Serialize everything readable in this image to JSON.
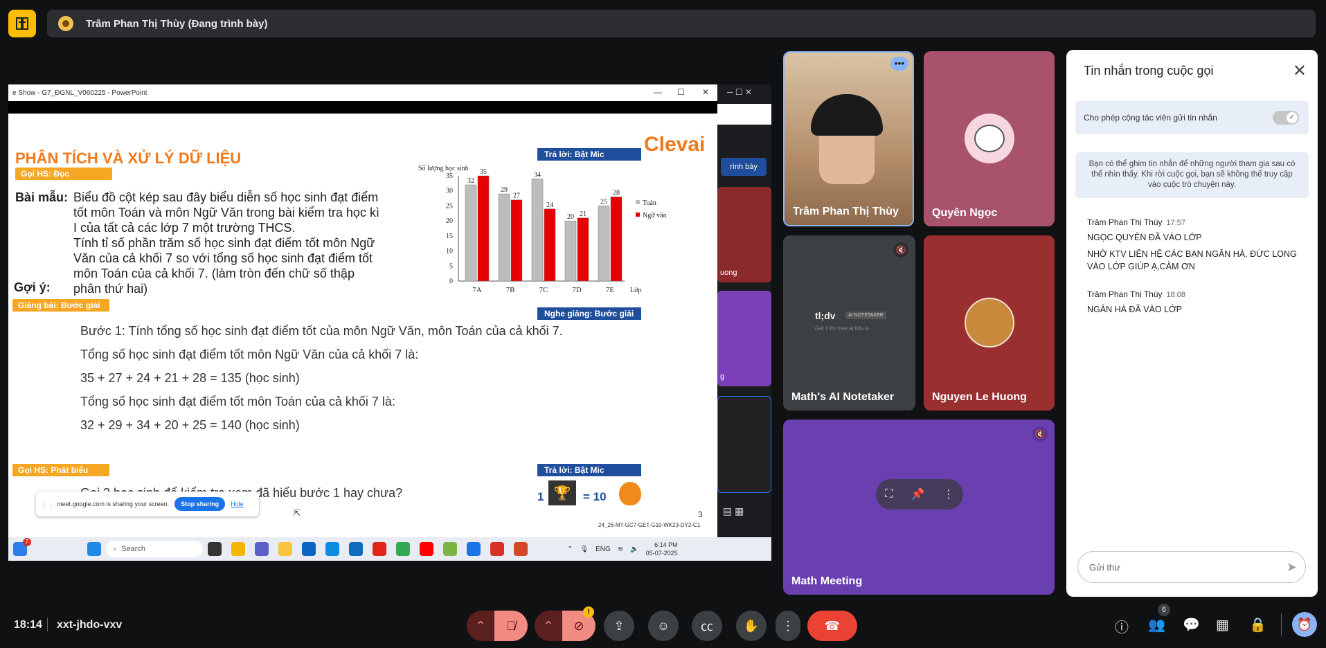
{
  "app": {
    "presenter_banner": "Trâm Phan Thị Thùy (Đang trình bày)",
    "time": "18:14",
    "meeting_code": "xxt-jhdo-vxv",
    "participants_count": "6"
  },
  "shared_window": {
    "title": "e Show - G7_ĐGNL_V060225 - PowerPoint",
    "share_notice": "meet.google.com is sharing your screen.",
    "stop_sharing": "Stop sharing",
    "hide": "Hide",
    "side_label": "rình bày",
    "side_tile_label": "uong",
    "side_tile_label2": "g"
  },
  "slide": {
    "title": "PHÂN TÍCH VÀ XỬ LÝ DỮ LIỆU",
    "brand": "Clevai",
    "tag_read": "Gọi HS: Đọc",
    "tag_teach": "Giảng bài: Bước giải",
    "tag_speak": "Gọi HS: Phát biểu",
    "tag_answer_top": "Trả lời: Bật Mic",
    "tag_listen": "Nghe giảng: Bước giải",
    "tag_answer_bottom": "Trả lời: Bật Mic",
    "sample_label": "Bài mẫu:",
    "hint_label": "Gợi ý:",
    "problem_lines": [
      "Biểu đồ cột kép sau đây biểu diễn số học sinh đạt điểm",
      "tốt môn Toán và môn Ngữ Văn trong bài kiểm tra học kì",
      "I của tất cả các lớp 7 một trường THCS.",
      "Tính tỉ số phần trăm số học sinh đạt điểm tốt môn Ngữ",
      "Văn của cả khối 7 so với tổng số học sinh đạt điểm tốt",
      "môn Toán của cả khối 7. (làm tròn đến chữ số thập",
      "phân thứ hai)"
    ],
    "steps": [
      "Bước 1: Tính tổng số học sinh đạt điểm tốt của môn Ngữ Văn, môn Toán của cả khối 7.",
      "Tổng số học sinh đạt điểm tốt môn Ngữ Văn của cả khối 7 là:",
      "35 + 27 + 24 + 21 + 28 = 135 (học sinh)",
      "Tổng số học sinh đạt điểm tốt môn Toán của cả khối 7 là:",
      "32 + 29 + 34 + 20 + 25 = 140 (học sinh)"
    ],
    "question": "Gọi 2 học sinh để kiểm tra xem đã hiểu bước 1 hay chưa?",
    "reward_count": "1",
    "reward_equals": "= 10",
    "page_number": "3",
    "footer_code": "24_26-MT-GC7-GET-G10-WK23-DY2-C1"
  },
  "chart_data": {
    "type": "bar",
    "ylabel": "Số lượng học sinh",
    "xlabel": "Lớp",
    "categories": [
      "7A",
      "7B",
      "7C",
      "7D",
      "7E"
    ],
    "series": [
      {
        "name": "Toán",
        "values": [
          32,
          29,
          34,
          20,
          25
        ],
        "color": "#bdbdbd"
      },
      {
        "name": "Ngữ văn",
        "values": [
          35,
          27,
          24,
          21,
          28
        ],
        "color": "#e60000"
      }
    ],
    "yticks": [
      "0",
      "5",
      "10",
      "15",
      "20",
      "25",
      "30",
      "35"
    ],
    "ylim": [
      0,
      35
    ],
    "legend": "right"
  },
  "taskbar": {
    "search": "Search",
    "lang": "ENG",
    "clock_time": "6:14 PM",
    "clock_date": "05-07-2025",
    "badge": "7"
  },
  "tiles": [
    {
      "name": "Trâm Phan Thị Thùy",
      "color": "#c9a27a"
    },
    {
      "name": "Quyên Ngọc",
      "color": "#a8526b"
    },
    {
      "name": "Math's AI Notetaker",
      "color": "#3c4043"
    },
    {
      "name": "Nguyen Le Huong",
      "color": "#9a2f2f"
    },
    {
      "name": "Math Meeting",
      "color": "#6a3fb0"
    }
  ],
  "notetaker": {
    "brand": "tl;dv",
    "badge": "AI NOTETAKER",
    "tagline": "Get it for free at tldv.io"
  },
  "chat": {
    "title": "Tin nhắn trong cuộc gọi",
    "allow_label": "Cho phép cộng tác viên gửi tin nhắn",
    "pin_info": "Bạn có thể ghim tin nhắn để những người tham gia sau có thể nhìn thấy. Khi rời cuộc gọi, bạn sẽ không thể truy cập vào cuộc trò chuyện này.",
    "messages": [
      {
        "author": "Trâm Phan Thị Thùy",
        "time": "17:57",
        "lines": [
          "NGỌC QUYÊN ĐÃ VÀO LỚP",
          "NHỜ KTV LIÊN HỆ CÁC BẠN NGÂN HÀ, ĐỨC LONG VÀO LỚP GIÚP Ạ,CẢM ƠN"
        ]
      },
      {
        "author": "Trâm Phan Thị Thùy",
        "time": "18:08",
        "lines": [
          "NGÂN HÀ ĐÃ VÀO LỚP"
        ]
      }
    ],
    "input_placeholder": "Gửi thư"
  }
}
